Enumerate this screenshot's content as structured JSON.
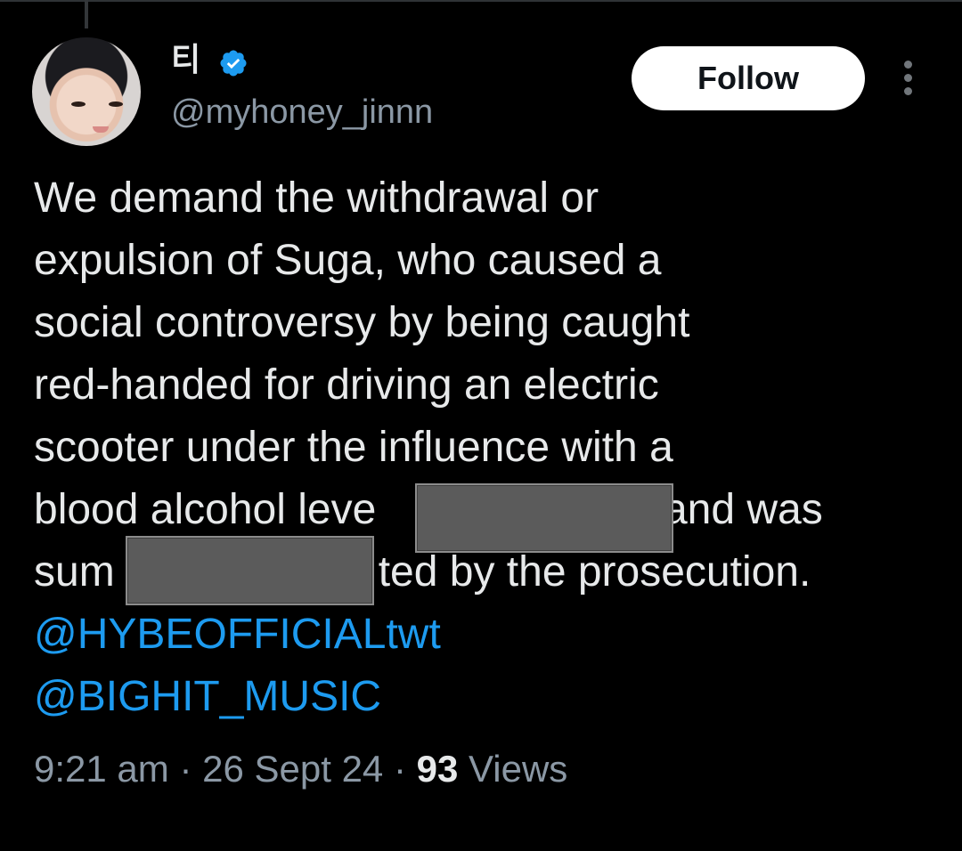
{
  "tweet": {
    "author": {
      "display_name": "티",
      "handle": "@myhoney_jinnn",
      "verified": true,
      "verified_color": "#1d9bf0"
    },
    "follow_label": "Follow",
    "text_lines": [
      "We demand the withdrawal or",
      "expulsion of Suga, who caused a",
      "social controversy by being caught",
      "red-handed for driving an electric",
      "scooter under the influence with a",
      "blood alcohol leve",
      "sum"
    ],
    "line6_tail": ", and was",
    "line7_tail": "ted by the prosecution.",
    "mentions": [
      "@HYBEOFFICIALtwt",
      "@BIGHIT_MUSIC"
    ],
    "time": "9:21 am",
    "separator": "·",
    "date": "26 Sept 24",
    "views_count": "93",
    "views_label": "Views",
    "mention_color": "#1d9bf0"
  }
}
